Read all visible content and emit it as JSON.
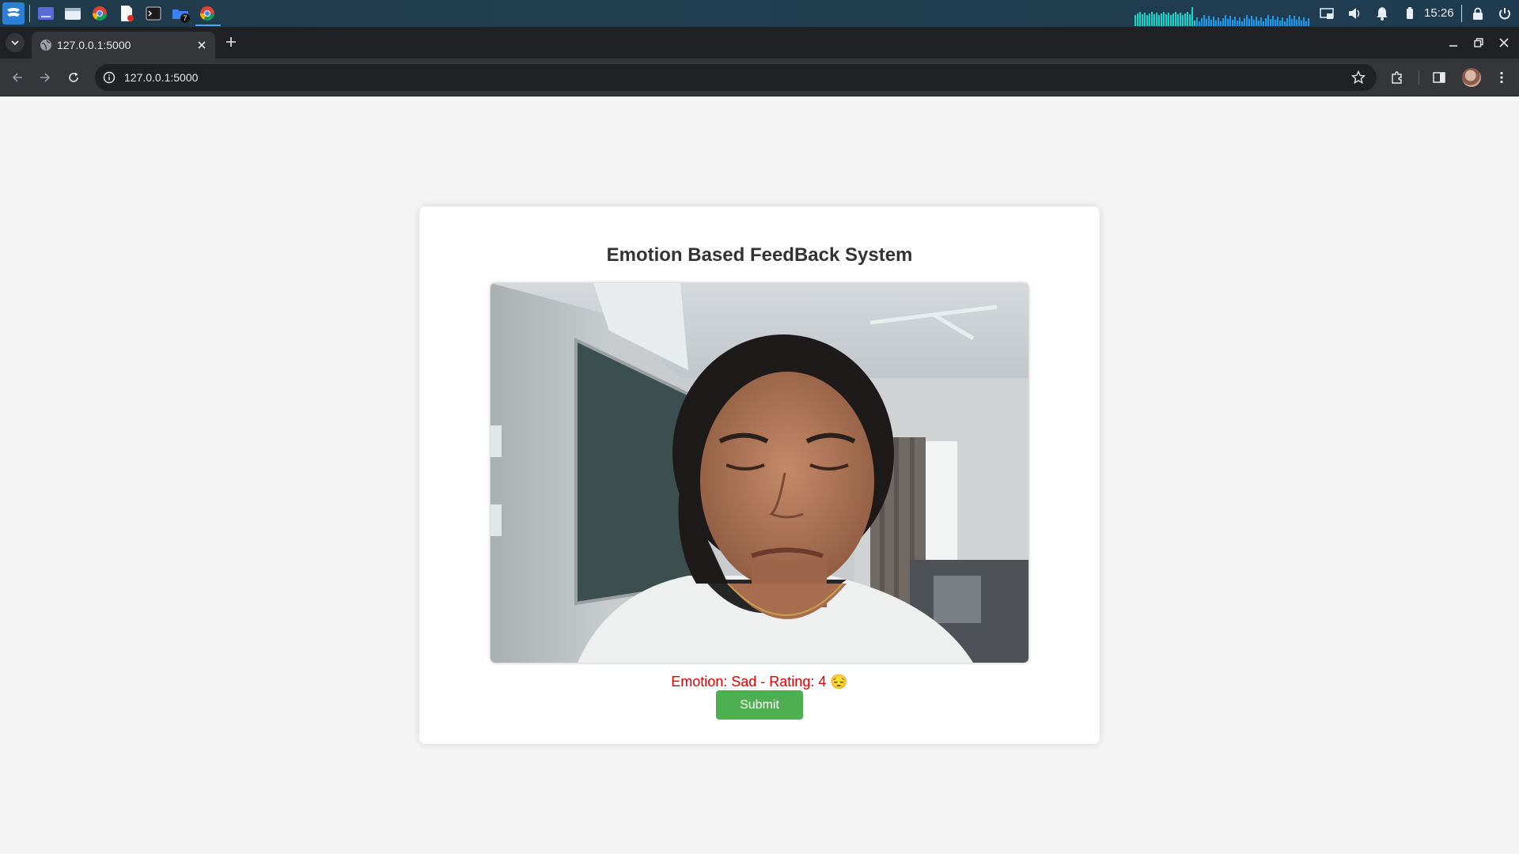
{
  "taskbar": {
    "badge_count": "7",
    "clock": "15:26"
  },
  "browser": {
    "tab_title": "127.0.0.1:5000",
    "url": "127.0.0.1:5000"
  },
  "page": {
    "heading": "Emotion Based FeedBack System",
    "emotion_text": "Emotion: Sad - Rating: 4 😔",
    "submit_label": "Submit"
  },
  "colors": {
    "submit_bg": "#4caf50",
    "emotion_text": "#e00000",
    "accent": "#4aa3ff"
  }
}
